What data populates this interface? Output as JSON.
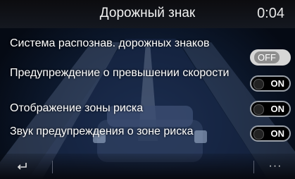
{
  "header": {
    "title": "Дорожный знак",
    "clock": "0:04"
  },
  "settings": [
    {
      "label": "Система распознав. дорожных знаков",
      "state": "OFF"
    },
    {
      "label": "Предупреждение о превышении скорости",
      "state": "ON"
    },
    {
      "label": "Отображение зоны риска",
      "state": "ON"
    },
    {
      "label": "Звук предупреждения о зоне риска",
      "state": "ON"
    }
  ],
  "footer": {
    "back_icon": "back-arrow-icon",
    "more_label": "···"
  },
  "colors": {
    "background": "#0d1a30",
    "toggle_border": "#9aa0a8",
    "off_badge": "#8e8e8e"
  }
}
